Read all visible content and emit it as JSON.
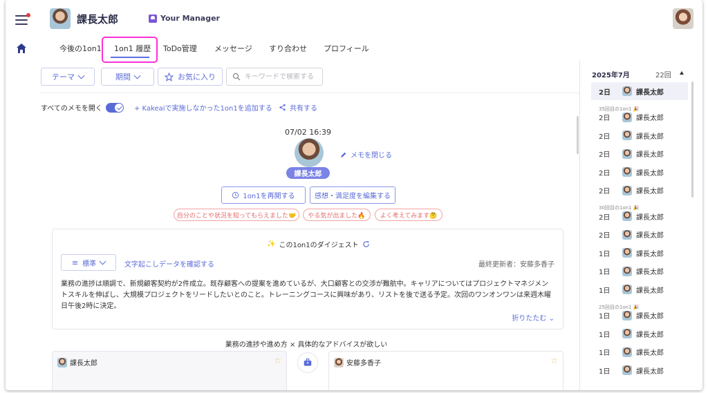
{
  "header": {
    "user_name": "課長太郎",
    "manager_label": "Your Manager"
  },
  "tabs": [
    {
      "label": "今後の1on1"
    },
    {
      "label": "1on1 履歴"
    },
    {
      "label": "ToDo管理"
    },
    {
      "label": "メッセージ"
    },
    {
      "label": "すり合わせ"
    },
    {
      "label": "プロフィール"
    }
  ],
  "filters": {
    "theme": "テーマ",
    "period": "期間",
    "favorite": "お気に入り",
    "search_placeholder": "キーワードで検索する"
  },
  "sub": {
    "open_all": "すべてのメモを開く",
    "add_external": "+ Kakeaiで実施しなかった1on1を追加する",
    "share": "共有する"
  },
  "session": {
    "datetime": "07/02 16:39",
    "name": "課長太郎",
    "close_memo": "メモを閉じる",
    "reopen": "1on1を再開する",
    "edit_feedback": "感想・満足度を編集する",
    "reactions": [
      "自分のことや状況を知ってもらえました🤝",
      "やる気が出ました🔥",
      "よく考えてみます🤔"
    ]
  },
  "digest": {
    "title": "この1on1のダイジェスト",
    "mode": "標準",
    "transcript": "文字起こしデータを確認する",
    "updated": "最終更新者：安藤多香子",
    "text": "業務の進捗は順調で、新規顧客契約が2件成立。既存顧客への提案を進めているが、大口顧客との交渉が難航中。キャリアについてはプロジェクトマネジメントスキルを伸ばし、大規模プロジェクトをリードしたいとのこと。トレーニングコースに興味があり、リストを後で送る予定。次回のワンオンワンは来週木曜日午後2時に決定。",
    "fold": "折りたたむ"
  },
  "topic": "業務の進捗や進め方 × 具体的なアドバイスが欲しい",
  "panels": {
    "left_name": "課長太郎",
    "right_name": "安藤多香子"
  },
  "sidebar": {
    "month": "2025年7月",
    "count": "22回",
    "rows": [
      {
        "day": "2日",
        "name": "課長太郎"
      },
      {
        "sep": "35回目の1on1 🎉"
      },
      {
        "day": "2日",
        "name": "課長太郎"
      },
      {
        "day": "2日",
        "name": "課長太郎"
      },
      {
        "day": "2日",
        "name": "課長太郎"
      },
      {
        "day": "2日",
        "name": "課長太郎"
      },
      {
        "day": "2日",
        "name": "課長太郎"
      },
      {
        "sep": "30回目の1on1 🎉"
      },
      {
        "day": "2日",
        "name": "課長太郎"
      },
      {
        "day": "2日",
        "name": "課長太郎"
      },
      {
        "day": "1日",
        "name": "課長太郎"
      },
      {
        "day": "1日",
        "name": "課長太郎"
      },
      {
        "day": "1日",
        "name": "課長太郎"
      },
      {
        "sep": "25回目の1on1 🎉"
      },
      {
        "day": "1日",
        "name": "課長太郎"
      },
      {
        "day": "1日",
        "name": "課長太郎"
      },
      {
        "day": "1日",
        "name": "課長太郎"
      },
      {
        "day": "1日",
        "name": "課長太郎"
      }
    ]
  },
  "colors": {
    "accent": "#5a6bd8",
    "highlight": "#ff2fd6"
  }
}
